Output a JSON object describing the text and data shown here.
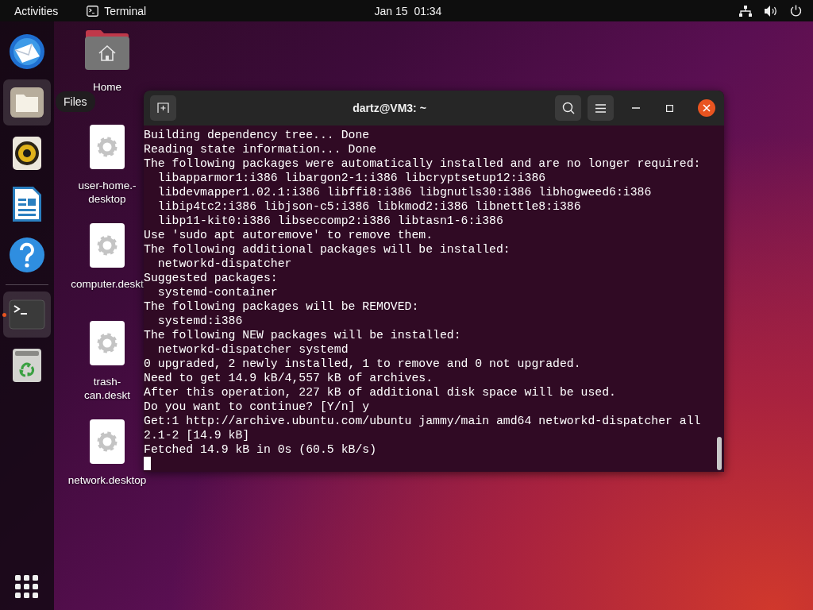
{
  "top_bar": {
    "activities": "Activities",
    "app_menu": "Terminal",
    "clock": "Jan 15  01:34"
  },
  "dock": {
    "tooltip": "Files",
    "items": [
      {
        "kind": "mail",
        "highlighted": false,
        "running": false
      },
      {
        "kind": "files",
        "highlighted": true,
        "running": false
      },
      {
        "kind": "music",
        "highlighted": false,
        "running": false
      },
      {
        "kind": "writer",
        "highlighted": false,
        "running": false
      },
      {
        "kind": "help",
        "highlighted": false,
        "running": false
      },
      {
        "kind": "terminal",
        "highlighted": true,
        "running": true
      },
      {
        "kind": "trash",
        "highlighted": false,
        "running": false
      }
    ]
  },
  "desktop_icons": [
    {
      "kind": "folder",
      "label": "Home"
    },
    {
      "kind": "launcher",
      "label": "user-home.-desktop"
    },
    {
      "kind": "launcher",
      "label": "computer.deskt"
    },
    {
      "kind": "launcher",
      "label": "trash-can.deskt"
    },
    {
      "kind": "launcher",
      "label": "network.desktop"
    }
  ],
  "terminal": {
    "title": "dartz@VM3: ~",
    "lines": [
      "Building dependency tree... Done",
      "Reading state information... Done",
      "The following packages were automatically installed and are no longer required:",
      "  libapparmor1:i386 libargon2-1:i386 libcryptsetup12:i386",
      "  libdevmapper1.02.1:i386 libffi8:i386 libgnutls30:i386 libhogweed6:i386",
      "  libip4tc2:i386 libjson-c5:i386 libkmod2:i386 libnettle8:i386",
      "  libp11-kit0:i386 libseccomp2:i386 libtasn1-6:i386",
      "Use 'sudo apt autoremove' to remove them.",
      "The following additional packages will be installed:",
      "  networkd-dispatcher",
      "Suggested packages:",
      "  systemd-container",
      "The following packages will be REMOVED:",
      "  systemd:i386",
      "The following NEW packages will be installed:",
      "  networkd-dispatcher systemd",
      "0 upgraded, 2 newly installed, 1 to remove and 0 not upgraded.",
      "Need to get 14.9 kB/4,557 kB of archives.",
      "After this operation, 227 kB of additional disk space will be used.",
      "Do you want to continue? [Y/n] y",
      "Get:1 http://archive.ubuntu.com/ubuntu jammy/main amd64 networkd-dispatcher all",
      "2.1-2 [14.9 kB]",
      "Fetched 14.9 kB in 0s (60.5 kB/s)"
    ]
  }
}
